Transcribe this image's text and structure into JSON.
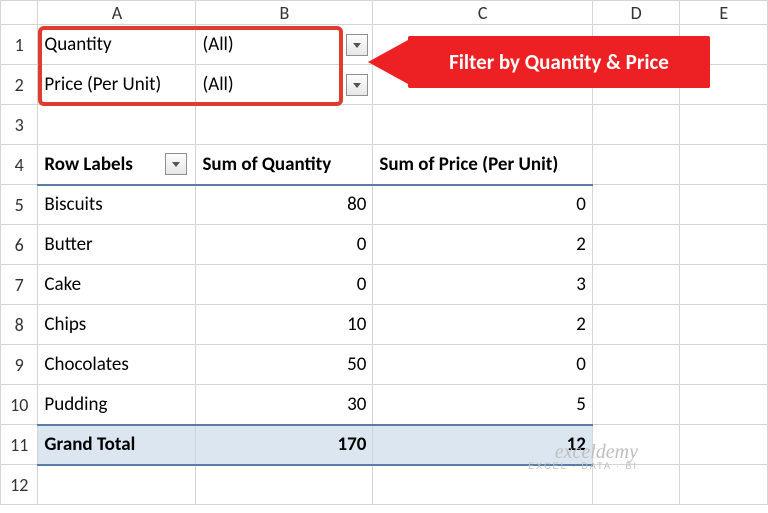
{
  "columns": [
    "A",
    "B",
    "C",
    "D",
    "E"
  ],
  "rows": [
    "1",
    "2",
    "3",
    "4",
    "5",
    "6",
    "7",
    "8",
    "9",
    "10",
    "11",
    "12"
  ],
  "filters": {
    "f1": {
      "label": "Quantity",
      "value": "(All)"
    },
    "f2": {
      "label": "Price (Per Unit)",
      "value": "(All)"
    }
  },
  "headers": {
    "rowlabels": "Row Labels",
    "sumqty": "Sum of Quantity",
    "sumprice": "Sum of Price (Per Unit)"
  },
  "data": [
    {
      "label": "Biscuits",
      "qty": "80",
      "price": "0"
    },
    {
      "label": "Butter",
      "qty": "0",
      "price": "2"
    },
    {
      "label": "Cake",
      "qty": "0",
      "price": "3"
    },
    {
      "label": "Chips",
      "qty": "10",
      "price": "2"
    },
    {
      "label": "Chocolates",
      "qty": "50",
      "price": "0"
    },
    {
      "label": "Pudding",
      "qty": "30",
      "price": "5"
    }
  ],
  "grand": {
    "label": "Grand Total",
    "qty": "170",
    "price": "12"
  },
  "callout": "Filter by Quantity & Price",
  "watermark": {
    "main": "exceldemy",
    "sub": "EXCEL · DATA · BI"
  }
}
